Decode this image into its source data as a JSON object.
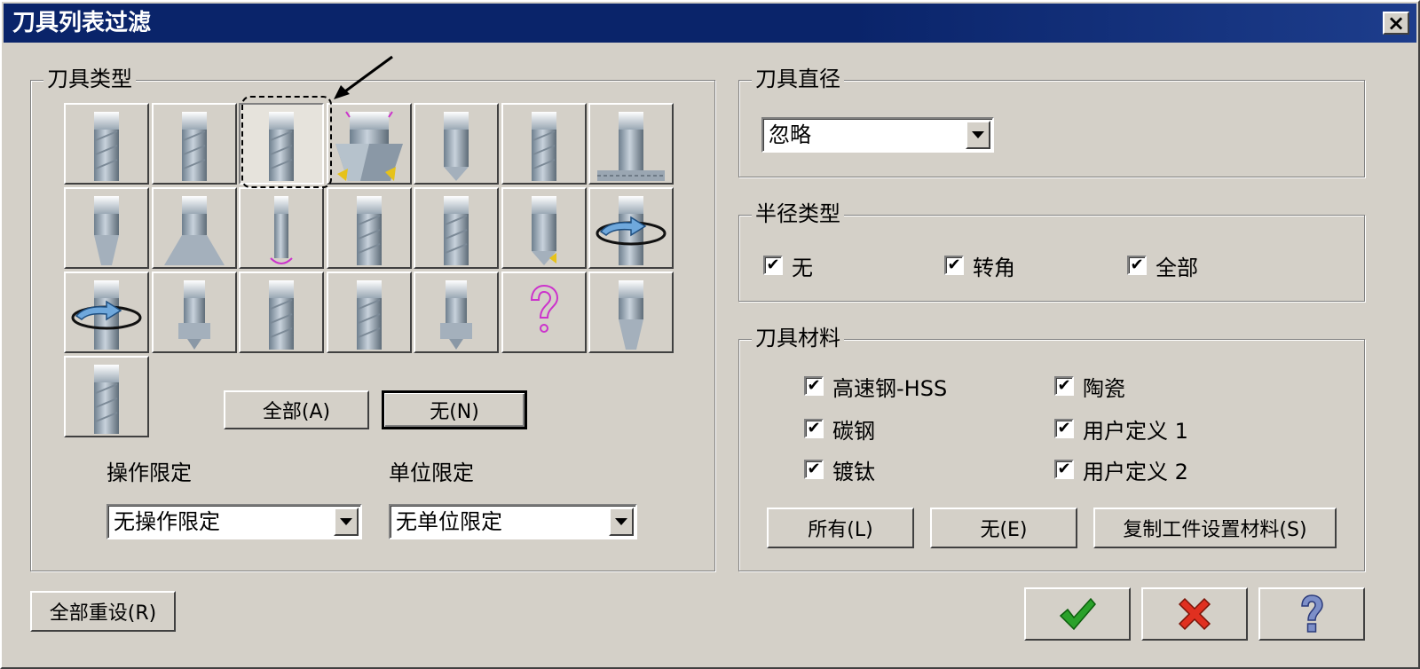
{
  "window": {
    "title": "刀具列表过滤",
    "close_glyph": "×"
  },
  "tool_type": {
    "label": "刀具类型",
    "tiles": [
      "flat-endmill-icon",
      "flat-endmill-icon",
      "flat-endmill-icon",
      "face-mill-icon",
      "drill-icon",
      "reamer-icon",
      "tap-icon",
      "chamfer-mill-icon",
      "taper-mill-icon",
      "lollipop-mill-icon",
      "bull-endmill-icon",
      "slot-mill-icon",
      "spot-drill-icon",
      "thread-mill-icon",
      "thread-mill-icon",
      "dovetail-mill-icon",
      "flat-endmill-icon",
      "flat-endmill-icon",
      "counterbore-icon",
      "unknown-tool-icon",
      "center-drill-icon",
      "flat-endmill-icon"
    ],
    "selected_index": 2,
    "all_button": "全部(A)",
    "none_button": "无(N)",
    "op_limit": {
      "label": "操作限定",
      "value": "无操作限定"
    },
    "unit_limit": {
      "label": "单位限定",
      "value": "无单位限定"
    }
  },
  "tool_diameter": {
    "label": "刀具直径",
    "value": "忽略"
  },
  "radius_type": {
    "label": "半径类型",
    "options": [
      {
        "label": "无",
        "checked": true
      },
      {
        "label": "转角",
        "checked": true
      },
      {
        "label": "全部",
        "checked": true
      }
    ]
  },
  "tool_material": {
    "label": "刀具材料",
    "options": [
      {
        "label": "高速钢-HSS",
        "checked": true
      },
      {
        "label": "陶瓷",
        "checked": true
      },
      {
        "label": "碳钢",
        "checked": true
      },
      {
        "label": "用户定义 1",
        "checked": true
      },
      {
        "label": "镀钛",
        "checked": true
      },
      {
        "label": "用户定义 2",
        "checked": true
      }
    ],
    "all_button": "所有(L)",
    "none_button": "无(E)",
    "copy_button": "复制工件设置材料(S)"
  },
  "footer": {
    "reset_button": "全部重设(R)"
  },
  "colors": {
    "title_bar": "#0a246a",
    "ok_green": "#2aa12a",
    "cancel_red": "#e03020",
    "help_blue": "#7d8fc8",
    "accent_magenta": "#cc33cc"
  }
}
